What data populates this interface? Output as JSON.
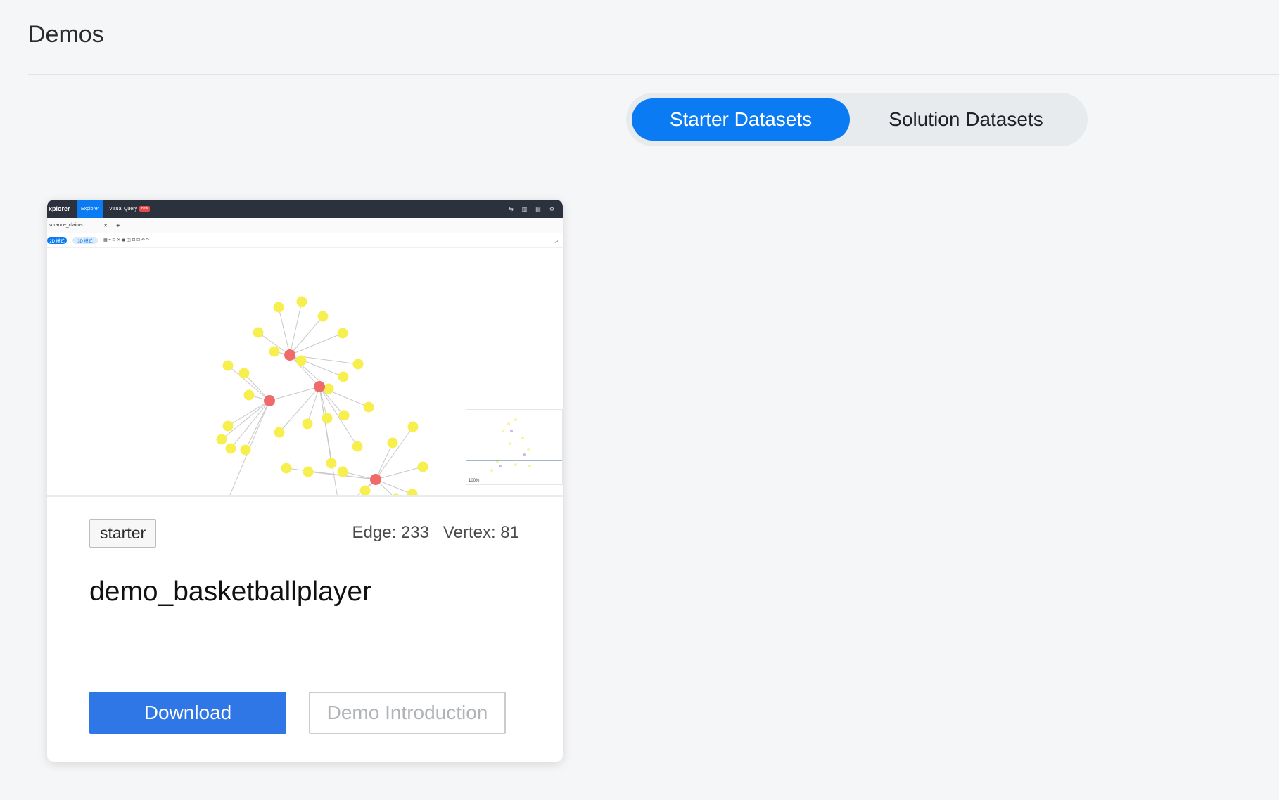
{
  "page": {
    "title": "Demos"
  },
  "tabs": {
    "starter_label": "Starter Datasets",
    "solution_label": "Solution Datasets",
    "active": "starter"
  },
  "card": {
    "tag": "starter",
    "edge_label": "Edge: 233",
    "vertex_label": "Vertex: 81",
    "title": "demo_basketballplayer",
    "download_label": "Download",
    "intro_label": "Demo Introduction",
    "thumbnail": {
      "brand": "xplorer",
      "tab_active": "Explorer",
      "tab_visual_query": "Visual Query",
      "new_badge": "new",
      "file_tab": "surance_claims",
      "mode_active": "2D 模式",
      "mode_3d": "3D 模式",
      "zoom": "100%",
      "hub_color": "#f06a6a",
      "leaf_color": "#f7ef4e"
    }
  },
  "colors": {
    "accent": "#0a7bf3",
    "download_button": "#2f76e6"
  }
}
